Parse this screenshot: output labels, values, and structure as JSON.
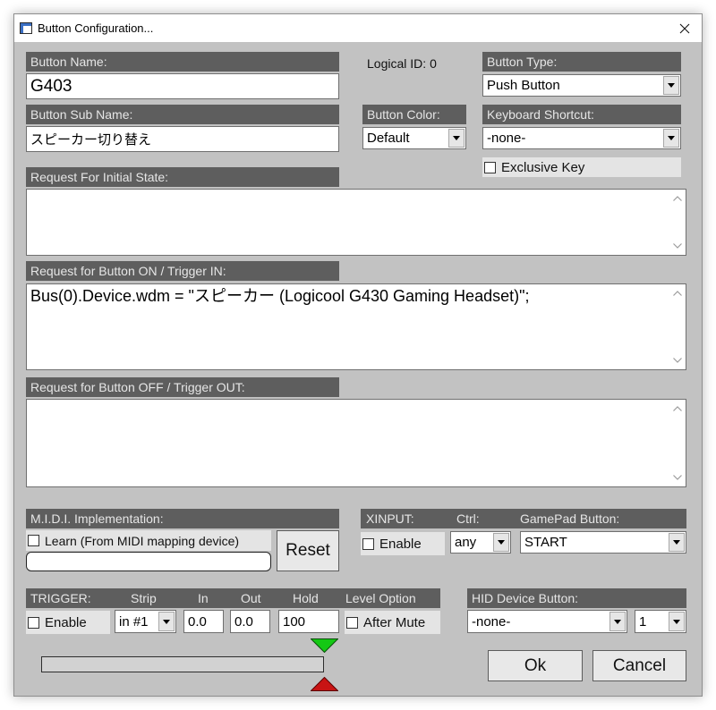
{
  "window": {
    "title": "Button Configuration...",
    "app_icon": "app-icon",
    "close_icon": "close-icon"
  },
  "colors": {
    "panel_bg": "#c2c2c2",
    "label_bar_bg": "#5e5e5e",
    "label_bar_text": "#e6e6e6",
    "option_area_bg": "#e4e4e4",
    "in_marker": "#14c814",
    "out_marker": "#c81414"
  },
  "button_name": {
    "label": "Button Name:",
    "value": "G403"
  },
  "logical_id": {
    "label": "Logical ID:",
    "value": 0
  },
  "button_type": {
    "label": "Button Type:",
    "selected": "Push Button"
  },
  "button_sub_name": {
    "label": "Button Sub Name:",
    "value": "スピーカー切り替え"
  },
  "button_color": {
    "label": "Button Color:",
    "selected": "Default"
  },
  "keyboard_shortcut": {
    "label": "Keyboard Shortcut:",
    "selected": "-none-",
    "exclusive_key_label": "Exclusive Key",
    "exclusive_key_checked": false
  },
  "request_initial_state": {
    "label": "Request For Initial State:",
    "script": ""
  },
  "request_on": {
    "label": "Request for Button ON / Trigger IN:",
    "script": "Bus(0).Device.wdm = \"スピーカー (Logicool G430 Gaming Headset)\";"
  },
  "request_off": {
    "label": "Request for Button OFF / Trigger OUT:",
    "script": ""
  },
  "midi": {
    "label": "M.I.D.I. Implementation:",
    "learn_label": "Learn (From MIDI mapping device)",
    "learn_checked": false,
    "mapping": "",
    "reset_label": "Reset"
  },
  "xinput": {
    "label": "XINPUT:",
    "ctrl_label": "Ctrl:",
    "gamepad_label": "GamePad Button:",
    "enable_label": "Enable",
    "enabled": false,
    "ctrl_selected": "any",
    "gamepad_selected": "START"
  },
  "trigger": {
    "label": "TRIGGER:",
    "strip_label": "Strip",
    "in_label": "In",
    "out_label": "Out",
    "hold_label": "Hold",
    "level_option_label": "Level Option",
    "enable_label": "Enable",
    "enabled": false,
    "strip_selected": "in #1",
    "in_value": "0.0",
    "out_value": "0.0",
    "hold_value": "100",
    "after_mute_label": "After Mute",
    "after_mute_checked": false
  },
  "hid": {
    "label": "HID Device Button:",
    "device_selected": "-none-",
    "button_selected": "1"
  },
  "level_meter": {
    "level": 0
  },
  "actions": {
    "ok_label": "Ok",
    "cancel_label": "Cancel"
  }
}
